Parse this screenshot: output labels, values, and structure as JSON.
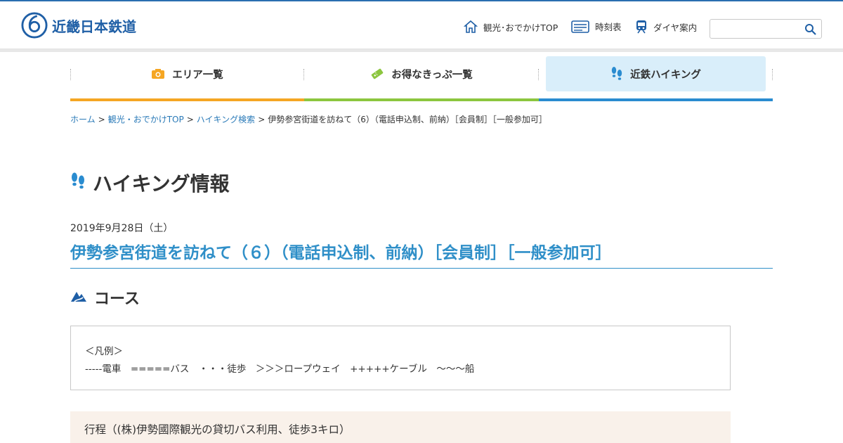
{
  "brand": {
    "name": "近畿日本鉄道",
    "color": "#1f5fa6"
  },
  "utility": [
    {
      "label": "観光･おでかけTOP",
      "icon": "home-icon"
    },
    {
      "label": "時刻表",
      "icon": "timetable-icon"
    },
    {
      "label": "ダイヤ案内",
      "icon": "train-icon"
    }
  ],
  "search": {
    "placeholder": "",
    "value": "",
    "icon": "search-icon"
  },
  "nav": [
    {
      "label": "エリア一覧",
      "icon": "camera-icon",
      "color": "#f5a623"
    },
    {
      "label": "お得なきっぷ一覧",
      "icon": "ticket-icon",
      "color": "#8cc63f"
    },
    {
      "label": "近鉄ハイキング",
      "icon": "footprints-icon",
      "color": "#2a8cd0",
      "active": true
    }
  ],
  "breadcrumb": {
    "home": "ホーム",
    "sightseeing": "観光・おでかけTOP",
    "hiking_search": "ハイキング検索",
    "current": "伊勢参宮街道を訪ねて（6）（電話申込制、前納）［会員制］［一般参加可］",
    "separator": ">"
  },
  "page": {
    "heading": "ハイキング情報",
    "date": "2019年9月28日（土）",
    "title": "伊勢参宮街道を訪ねて（６）（電話申込制、前納）［会員制］［一般参加可］",
    "accent": "#2f8fc8"
  },
  "course": {
    "heading": "コース",
    "legend_title": "＜凡例＞",
    "legend_items": "-----電車　=====バス　・・・徒歩　＞＞＞ロープウェイ　+++++ケーブル　〜〜〜船"
  },
  "route": {
    "title": "行程（(株)伊勢國際観光の貸切バス利用、徒歩3キロ）",
    "background": "#f9f1ea"
  }
}
